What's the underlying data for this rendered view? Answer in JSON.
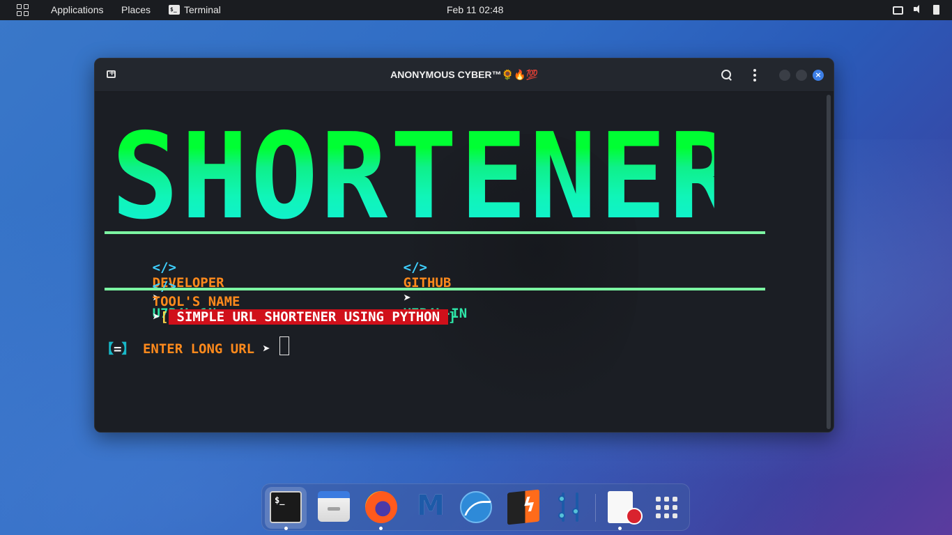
{
  "topbar": {
    "applications": "Applications",
    "places": "Places",
    "terminal_icon": "$_",
    "terminal": "Terminal",
    "clock": "Feb 11  02:48",
    "tray": [
      "screen-icon",
      "volume-icon",
      "battery-icon"
    ]
  },
  "window": {
    "title": "ANONYMOUS CYBER™🌻🔥💯",
    "close_glyph": "×"
  },
  "terminal": {
    "banner": "SHORTENER",
    "line1": {
      "tag1": "</>",
      "label1": "DEVELOPER",
      "arrow1": "➤",
      "value1": "U7P4L 1N",
      "tag2": "</>",
      "label2": "GITHUB",
      "arrow2": "➤",
      "value2": "U7P4L-IN"
    },
    "line2": {
      "tag": "</>",
      "label": "TOOL'S NAME",
      "arrow": "➤",
      "open_bracket": "[",
      "value": "SIMPLE URL SHORTENER USING PYTHON",
      "close_bracket": "]"
    },
    "prompt": {
      "open": "【",
      "symbol": "=",
      "close": "】",
      "label": "ENTER LONG URL",
      "arrow": "➤"
    }
  },
  "dock": {
    "items": [
      "terminal-icon",
      "files-icon",
      "firefox-icon",
      "metasploit-icon",
      "wireshark-icon",
      "burpsuite-icon",
      "mixer-icon",
      "text-editor-icon",
      "app-grid-icon"
    ],
    "terminal_glyph": "$_"
  },
  "colors": {
    "banner_top": "#00ff33",
    "banner_bottom": "#10f0d0",
    "rule": "#7cf5a2",
    "label_orange": "#ff8a1c",
    "value_green": "#2ee6a8",
    "tag_cyan": "#3fd0ff",
    "highlight_red": "#d0101a",
    "close_button": "#3d7fe6"
  }
}
